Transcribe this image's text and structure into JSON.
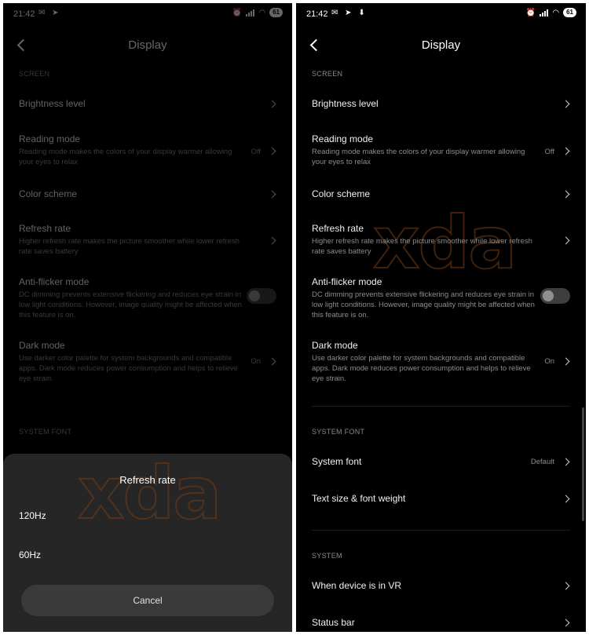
{
  "status": {
    "time": "21:42",
    "left_icons_left": "✉ ➤",
    "left_icons_right": "✉ ➤ ⬇",
    "alarm": "⏰",
    "wifi": "◠",
    "battery": "61"
  },
  "header": {
    "title": "Display"
  },
  "sections": {
    "screen": "SCREEN",
    "system_font": "SYSTEM FONT",
    "system": "SYSTEM"
  },
  "settings": {
    "brightness": {
      "title": "Brightness level"
    },
    "reading": {
      "title": "Reading mode",
      "desc": "Reading mode makes the colors of your display warmer allowing your eyes to relax",
      "value": "Off"
    },
    "color_scheme": {
      "title": "Color scheme"
    },
    "refresh": {
      "title": "Refresh rate",
      "desc": "Higher refresh rate makes the picture smoother while lower refresh rate saves battery"
    },
    "antiflicker": {
      "title": "Anti-flicker mode",
      "desc": "DC dimming prevents extensive flickering and reduces eye strain in low light conditions. However, image quality might be affected when this feature is on.",
      "enabled": false
    },
    "dark_mode": {
      "title": "Dark mode",
      "desc": "Use darker color palette for system backgrounds and compatible apps. Dark mode reduces power consumption and helps to relieve eye strain.",
      "value": "On"
    },
    "system_font": {
      "title": "System font",
      "value": "Default"
    },
    "text_size": {
      "title": "Text size & font weight"
    },
    "vr": {
      "title": "When device is in VR"
    },
    "status_bar": {
      "title": "Status bar"
    }
  },
  "dialog": {
    "title": "Refresh rate",
    "options": [
      "120Hz",
      "60Hz"
    ],
    "cancel": "Cancel"
  },
  "watermark": "xda",
  "colors": {
    "background": "#000000",
    "sheet": "#262626",
    "watermark": "#783c14"
  }
}
